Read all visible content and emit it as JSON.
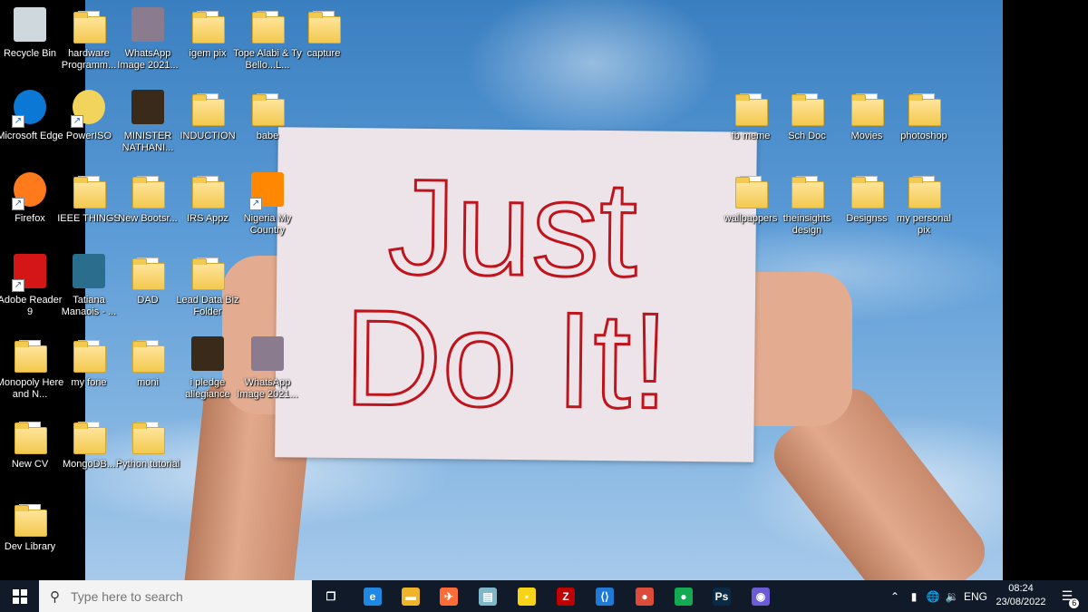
{
  "desktop": {
    "colors": {
      "sign_text": "#c0141c",
      "sky": "#5b9bd6"
    },
    "sign_lines": [
      "Just",
      "Do It!"
    ],
    "icons": [
      {
        "label": "Recycle Bin",
        "icon": "recycle-bin-icon"
      },
      {
        "label": "hardware Programm...",
        "icon": "folder-icon"
      },
      {
        "label": "WhatsApp Image 2021...",
        "icon": "image-file-icon"
      },
      {
        "label": "igem pix",
        "icon": "folder-icon"
      },
      {
        "label": "Tope Alabi & Ty Bello...L...",
        "icon": "folder-icon"
      },
      {
        "label": "capture",
        "icon": "folder-icon"
      },
      {
        "label": "Microsoft Edge",
        "icon": "edge-icon"
      },
      {
        "label": "PowerISO",
        "icon": "poweriso-icon"
      },
      {
        "label": "MINISTER NATHANI...",
        "icon": "video-file-icon"
      },
      {
        "label": "INDUCTION",
        "icon": "folder-icon"
      },
      {
        "label": "babe",
        "icon": "folder-icon"
      },
      {
        "label": "fb meme",
        "icon": "folder-icon"
      },
      {
        "label": "Sch Doc",
        "icon": "folder-icon"
      },
      {
        "label": "Movies",
        "icon": "folder-icon"
      },
      {
        "label": "photoshop",
        "icon": "folder-icon"
      },
      {
        "label": "Firefox",
        "icon": "firefox-icon"
      },
      {
        "label": "IEEE THINGS",
        "icon": "folder-icon"
      },
      {
        "label": "New Bootsr...",
        "icon": "folder-icon"
      },
      {
        "label": "IRS Appz",
        "icon": "folder-icon"
      },
      {
        "label": "Nigeria My Country",
        "icon": "vlc-icon"
      },
      {
        "label": "wallpappers",
        "icon": "folder-icon"
      },
      {
        "label": "theinsights design",
        "icon": "folder-icon"
      },
      {
        "label": "Designss",
        "icon": "folder-icon"
      },
      {
        "label": "my personal pix",
        "icon": "folder-icon"
      },
      {
        "label": "Adobe Reader 9",
        "icon": "adobe-reader-icon"
      },
      {
        "label": "Tatiana Manaois - ...",
        "icon": "music-file-icon"
      },
      {
        "label": "DAD",
        "icon": "folder-icon"
      },
      {
        "label": "Lead Data Biz Folder",
        "icon": "folder-icon"
      },
      {
        "label": "Monopoly Here and N...",
        "icon": "folder-icon"
      },
      {
        "label": "my fone",
        "icon": "folder-icon"
      },
      {
        "label": "moni",
        "icon": "folder-icon"
      },
      {
        "label": "i pledge allegiance",
        "icon": "video-file-icon"
      },
      {
        "label": "WhatsApp Image 2021...",
        "icon": "image-file-icon"
      },
      {
        "label": "New CV",
        "icon": "folder-icon"
      },
      {
        "label": "MongoDB...",
        "icon": "folder-icon"
      },
      {
        "label": "Python tutorial",
        "icon": "folder-icon"
      },
      {
        "label": "Dev Library",
        "icon": "folder-icon"
      }
    ]
  },
  "taskbar": {
    "search_placeholder": "Type here to search",
    "apps": [
      {
        "icon": "task-view-icon",
        "glyph": "❐",
        "color": "#101a28"
      },
      {
        "icon": "edge-icon",
        "glyph": "e",
        "color": "#1e88e5"
      },
      {
        "icon": "file-explorer-icon",
        "glyph": "▬",
        "color": "#f0b429"
      },
      {
        "icon": "postman-icon",
        "glyph": "✈",
        "color": "#ff6c37"
      },
      {
        "icon": "notepad-icon",
        "glyph": "▤",
        "color": "#7fb7c8"
      },
      {
        "icon": "sticky-notes-icon",
        "glyph": "▪",
        "color": "#f7d417"
      },
      {
        "icon": "filezilla-icon",
        "glyph": "Z",
        "color": "#bf0000"
      },
      {
        "icon": "vscode-icon",
        "glyph": "⟨⟩",
        "color": "#1e7ad6"
      },
      {
        "icon": "chrome-icon",
        "glyph": "●",
        "color": "#dd4b39"
      },
      {
        "icon": "mongodb-compass-icon",
        "glyph": "●",
        "color": "#13aa52"
      },
      {
        "icon": "photoshop-icon",
        "glyph": "Ps",
        "color": "#0c2a46"
      },
      {
        "icon": "app-circle-icon",
        "glyph": "◉",
        "color": "#6b5bd6"
      }
    ],
    "tray": {
      "language": "ENG",
      "time": "08:24",
      "date": "23/08/2022",
      "notification_count": "6"
    }
  }
}
